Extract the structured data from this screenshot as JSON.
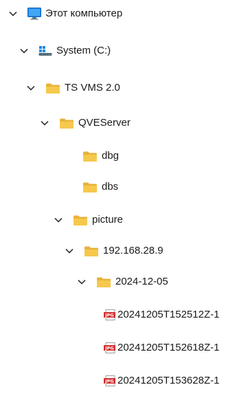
{
  "tree": {
    "this_pc": {
      "label": "Этот компьютер",
      "icon": "monitor-icon",
      "expanded": true
    },
    "system_c": {
      "label": "System (C:)",
      "icon": "windows-drive-icon",
      "expanded": true
    },
    "ts_vms": {
      "label": "TS VMS 2.0",
      "icon": "folder-icon",
      "expanded": true
    },
    "qveserver": {
      "label": "QVEServer",
      "icon": "folder-icon",
      "expanded": true
    },
    "dbg": {
      "label": "dbg",
      "icon": "folder-icon"
    },
    "dbs": {
      "label": "dbs",
      "icon": "folder-icon"
    },
    "picture": {
      "label": "picture",
      "icon": "folder-icon",
      "expanded": true
    },
    "ip_folder": {
      "label": "192.168.28.9",
      "icon": "folder-icon",
      "expanded": true
    },
    "date_folder": {
      "label": "2024-12-05",
      "icon": "folder-icon",
      "expanded": true
    },
    "files": [
      {
        "label": "20241205T152512Z-1",
        "icon": "jpg-file-icon",
        "badge": "JPG"
      },
      {
        "label": "20241205T152618Z-1",
        "icon": "jpg-file-icon",
        "badge": "JPG"
      },
      {
        "label": "20241205T153628Z-1",
        "icon": "jpg-file-icon",
        "badge": "JPG"
      }
    ]
  },
  "colors": {
    "folder": "#f6c94d",
    "folder_dark": "#e8b23a",
    "monitor": "#1e88e5",
    "jpg_badge": "#d32f2f",
    "text": "#1a1a1a",
    "chevron": "#333333"
  }
}
